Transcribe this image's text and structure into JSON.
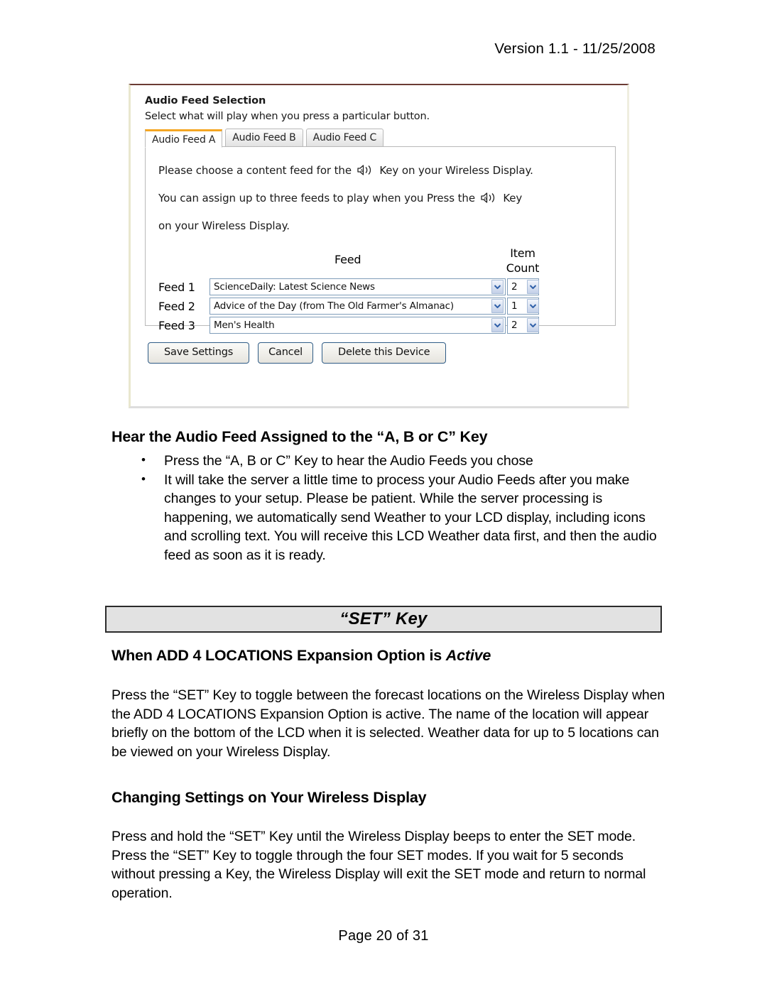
{
  "header": {
    "version": "Version 1.1 - 11/25/2008"
  },
  "screenshot": {
    "title": "Audio Feed Selection",
    "subtitle": "Select what will play when you press a particular button.",
    "tabs": [
      {
        "label": "Audio Feed A",
        "active": true
      },
      {
        "label": "Audio Feed B",
        "active": false
      },
      {
        "label": "Audio Feed C",
        "active": false
      }
    ],
    "instructions": {
      "line1_before": "Please choose a content feed for the",
      "line1_after": "Key on your Wireless Display.",
      "line2_before": "You can assign up to three feeds to play when you Press the",
      "line2_after": "Key",
      "line3": "on your Wireless Display."
    },
    "columns": {
      "feed": "Feed",
      "item_count_line1": "Item",
      "item_count_line2": "Count"
    },
    "rows": [
      {
        "label": "Feed 1",
        "feed": "ScienceDaily: Latest Science News",
        "count": "2"
      },
      {
        "label": "Feed 2",
        "feed": "Advice of the Day (from The Old Farmer's Almanac)",
        "count": "1"
      },
      {
        "label": "Feed 3",
        "feed": "Men's Health",
        "count": "2"
      }
    ],
    "buttons": {
      "save": "Save Settings",
      "cancel": "Cancel",
      "delete": "Delete this Device"
    },
    "icons": {
      "speaker": "speaker-a-icon",
      "dropdown": "chevron-down-icon"
    },
    "colors": {
      "active_tab_accent": "#f5a623",
      "select_border": "#7f9db9",
      "button_border": "#2f5c86",
      "panel_top_border": "#6b3b34"
    }
  },
  "section_audio": {
    "heading": "Hear the Audio Feed Assigned to the “A, B or C” Key",
    "bullets": [
      "Press the “A, B or C” Key to hear the Audio Feeds  you chose",
      "It will take the server a little time to process your Audio Feeds after you make changes to your setup.  Please be patient.  While the server processing is happening, we automatically send Weather to your LCD display, including icons and scrolling text.  You will receive this LCD Weather data first, and then the audio feed as soon as it is ready."
    ]
  },
  "section_set": {
    "banner": "“SET” Key",
    "heading_plain": "When ADD 4 LOCATIONS Expansion Option is ",
    "heading_italic": "Active",
    "paragraph": "Press the “SET” Key to toggle between the forecast locations on the Wireless Display when the ADD 4 LOCATIONS Expansion Option is active. The name of the location will appear briefly on the bottom of the LCD when it is selected. Weather data for up to 5 locations can be viewed on your Wireless Display."
  },
  "section_changing": {
    "heading": "Changing Settings on Your Wireless Display",
    "paragraph": "Press and hold the “SET” Key until the Wireless Display beeps to enter the SET mode. Press the “SET” Key to toggle through the four SET modes.  If you wait for 5 seconds without pressing a Key, the Wireless Display will exit the SET mode and return to normal operation."
  },
  "footer": {
    "page": "Page 20 of 31"
  }
}
